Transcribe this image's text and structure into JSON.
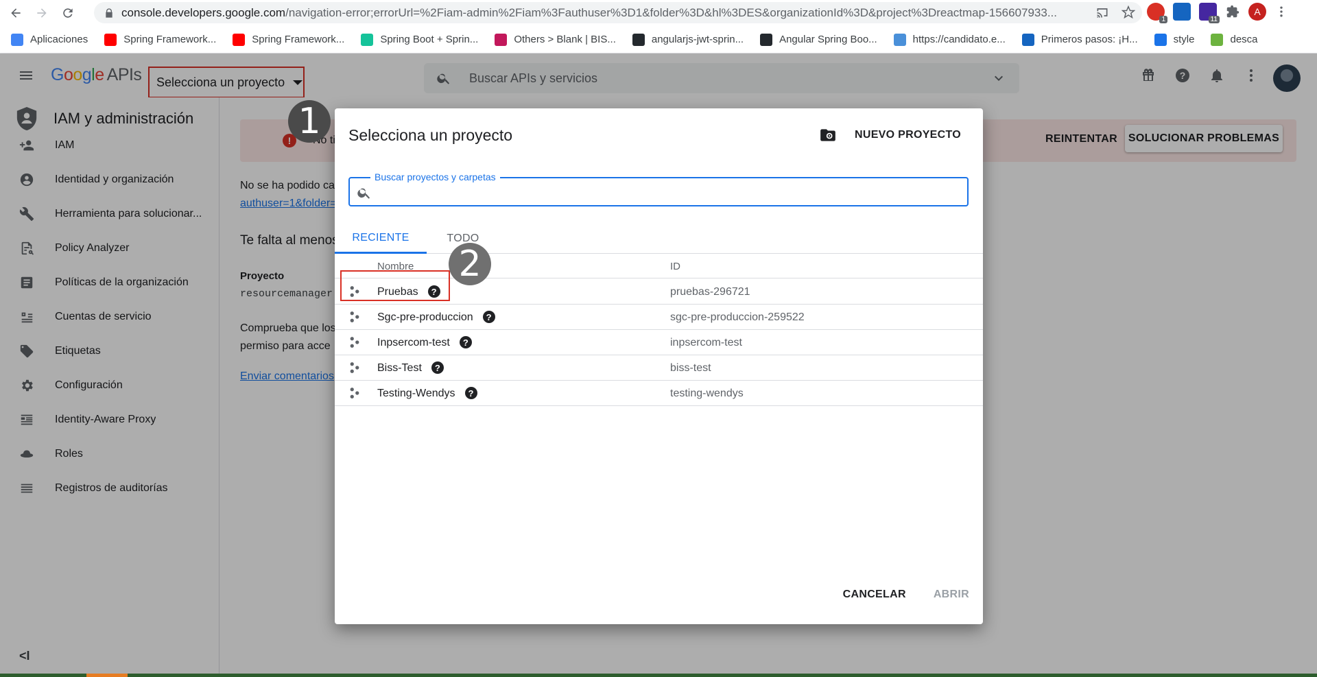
{
  "browser": {
    "url_host": "console.developers.google.com",
    "url_rest": "/navigation-error;errorUrl=%2Fiam-admin%2Fiam%3Fauthuser%3D1&folder%3D&hl%3DES&organizationId%3D&project%3Dreactmap-156607933...",
    "ext_badge_1": "1",
    "ext_badge_2": "11",
    "profile_initial": "A",
    "bookmarks": [
      {
        "label": "Aplicaciones",
        "icon": "apps-grid-icon",
        "color": "#4285f4"
      },
      {
        "label": "Spring Framework...",
        "icon": "youtube-icon",
        "color": "#ff0000"
      },
      {
        "label": "Spring Framework...",
        "icon": "youtube-icon",
        "color": "#ff0000"
      },
      {
        "label": "Spring Boot + Sprin...",
        "icon": "grammarly-icon",
        "color": "#15c39a"
      },
      {
        "label": "Others > Blank | BIS...",
        "icon": "box-icon",
        "color": "#c2185b"
      },
      {
        "label": "angularjs-jwt-sprin...",
        "icon": "github-icon",
        "color": "#24292e"
      },
      {
        "label": "Angular Spring Boo...",
        "icon": "github-icon",
        "color": "#24292e"
      },
      {
        "label": "https://candidato.e...",
        "icon": "chart-icon",
        "color": "#4a90d9"
      },
      {
        "label": "Primeros pasos: ¡H...",
        "icon": "play-icon",
        "color": "#1565c0"
      },
      {
        "label": "style",
        "icon": "diamond-icon",
        "color": "#1a73e8"
      },
      {
        "label": "desca",
        "icon": "spring-icon",
        "color": "#6db33f"
      }
    ]
  },
  "header": {
    "logo_g": "G",
    "logo_o1": "o",
    "logo_o2": "o",
    "logo_g2": "g",
    "logo_l": "l",
    "logo_e": "e",
    "logo_apis": "APIs",
    "project_picker": "Selecciona un proyecto",
    "search_placeholder": "Buscar APIs y servicios"
  },
  "sidebar": {
    "title": "IAM y administración",
    "items": [
      {
        "label": "IAM",
        "icon": "person-add-icon"
      },
      {
        "label": "Identidad y organización",
        "icon": "account-circle-icon"
      },
      {
        "label": "Herramienta para solucionar...",
        "icon": "wrench-icon"
      },
      {
        "label": "Policy Analyzer",
        "icon": "policy-icon"
      },
      {
        "label": "Políticas de la organización",
        "icon": "article-icon"
      },
      {
        "label": "Cuentas de servicio",
        "icon": "service-account-icon"
      },
      {
        "label": "Etiquetas",
        "icon": "tag-icon"
      },
      {
        "label": "Configuración",
        "icon": "gear-icon"
      },
      {
        "label": "Identity-Aware Proxy",
        "icon": "proxy-icon"
      },
      {
        "label": "Roles",
        "icon": "hat-icon"
      },
      {
        "label": "Registros de auditorías",
        "icon": "list-icon"
      }
    ],
    "collapse": "<I"
  },
  "main": {
    "error_text": "No tiene",
    "retry": "REINTENTAR",
    "fix": "SOLUCIONAR PROBLEMAS",
    "line1": "No se ha podido ca",
    "line2": "authuser=1&folder=",
    "heading": "Te falta al menos",
    "project_label": "Proyecto",
    "perm": "resourcemanager",
    "check1": "Comprueba que los",
    "check2": "permiso para acce",
    "feedback": "Enviar comentarios"
  },
  "dialog": {
    "title": "Selecciona un proyecto",
    "new_project": "NUEVO PROYECTO",
    "search_label": "Buscar proyectos y carpetas",
    "search_value": "",
    "tabs": [
      {
        "label": "RECIENTE",
        "active": true
      },
      {
        "label": "TODO",
        "active": false
      }
    ],
    "columns": {
      "name": "Nombre",
      "id": "ID"
    },
    "projects": [
      {
        "name": "Pruebas",
        "id": "pruebas-296721"
      },
      {
        "name": "Sgc-pre-produccion",
        "id": "sgc-pre-produccion-259522"
      },
      {
        "name": "Inpsercom-test",
        "id": "inpsercom-test"
      },
      {
        "name": "Biss-Test",
        "id": "biss-test"
      },
      {
        "name": "Testing-Wendys",
        "id": "testing-wendys"
      }
    ],
    "help_glyph": "?",
    "cancel": "CANCELAR",
    "open": "ABRIR"
  },
  "markers": {
    "step1": "1",
    "step2": "2"
  },
  "colors": {
    "accent": "#1a73e8",
    "highlight": "#d93025",
    "error_bg": "#fce8e6"
  }
}
